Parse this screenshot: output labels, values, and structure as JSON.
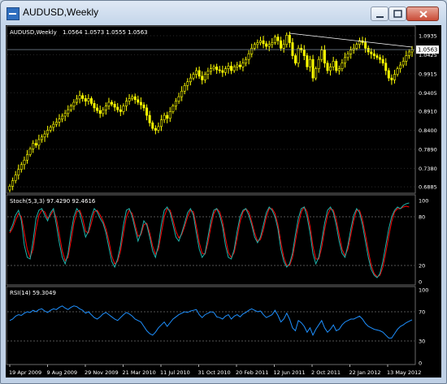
{
  "window": {
    "title": "AUDUSD,Weekly"
  },
  "buttons": {
    "minimize": "minimize",
    "maximize": "maximize",
    "close": "close"
  },
  "colors": {
    "background": "#000000",
    "candles": "#ffff00",
    "stoch_main": "#20b2aa",
    "stoch_signal": "#ff0000",
    "rsi_line": "#1e90ff",
    "text": "#ffffff",
    "grid": "#5a5a5a"
  },
  "chart_data": {
    "type": "candlestick",
    "symbol": "AUDUSD,Weekly",
    "header_values": "1.0564 1.0573 1.0555 1.0563",
    "price_ticks": [
      "1.0935",
      "1.0425",
      "0.9915",
      "0.9405",
      "0.8910",
      "0.8400",
      "0.7890",
      "0.7380",
      "0.6885"
    ],
    "current_price": "1.0563",
    "x_labels": [
      "19 Apr 2009",
      "9 Aug 2009",
      "29 Nov 2009",
      "21 Mar 2010",
      "11 Jul 2010",
      "31 Oct 2010",
      "20 Feb 2011",
      "12 Jun 2011",
      "2 Oct 2011",
      "22 Jan 2012",
      "13 May 2012"
    ],
    "price_close": [
      0.69,
      0.705,
      0.72,
      0.735,
      0.748,
      0.76,
      0.775,
      0.79,
      0.805,
      0.8,
      0.815,
      0.822,
      0.83,
      0.84,
      0.848,
      0.856,
      0.862,
      0.87,
      0.878,
      0.885,
      0.895,
      0.905,
      0.915,
      0.924,
      0.933,
      0.925,
      0.918,
      0.925,
      0.912,
      0.9,
      0.893,
      0.885,
      0.895,
      0.905,
      0.915,
      0.91,
      0.902,
      0.895,
      0.89,
      0.905,
      0.918,
      0.925,
      0.93,
      0.922,
      0.915,
      0.908,
      0.9,
      0.88,
      0.86,
      0.845,
      0.84,
      0.85,
      0.868,
      0.88,
      0.872,
      0.89,
      0.905,
      0.918,
      0.93,
      0.945,
      0.96,
      0.97,
      0.98,
      0.99,
      1.0,
      0.985,
      0.975,
      0.99,
      0.998,
      1.005,
      1.01,
      1.002,
      1.0,
      0.995,
      1.005,
      1.012,
      1.0,
      1.01,
      1.015,
      1.01,
      1.02,
      1.03,
      1.045,
      1.06,
      1.07,
      1.075,
      1.08,
      1.072,
      1.065,
      1.07,
      1.075,
      1.09,
      1.08,
      1.06,
      1.07,
      1.095,
      1.075,
      1.04,
      1.02,
      1.06,
      1.055,
      1.04,
      1.01,
      1.03,
      0.98,
      1.005,
      1.03,
      1.055,
      1.02,
      1.0,
      1.01,
      1.025,
      1.0,
      1.005,
      1.02,
      1.035,
      1.045,
      1.055,
      1.06,
      1.07,
      1.08,
      1.075,
      1.06,
      1.05,
      1.045,
      1.04,
      1.035,
      1.03,
      1.02,
      1.0,
      0.98,
      0.975,
      0.99,
      1.005,
      1.015,
      1.025,
      1.04,
      1.05,
      1.056
    ],
    "trendline": {
      "from_index": 96,
      "from_price": 1.1,
      "to_index": 138,
      "to_price": 1.063
    },
    "hline_price": 1.0563,
    "price_ylim": [
      0.68,
      1.1
    ],
    "stoch": {
      "label": "Stoch(5,3,3) 97.4290 92.4616",
      "levels": [
        "100",
        "80",
        "20",
        "0"
      ],
      "main": [
        62,
        70,
        82,
        88,
        75,
        45,
        30,
        28,
        50,
        78,
        88,
        90,
        82,
        75,
        85,
        90,
        70,
        48,
        30,
        22,
        35,
        60,
        80,
        90,
        85,
        70,
        55,
        62,
        80,
        90,
        86,
        78,
        72,
        60,
        42,
        25,
        18,
        28,
        45,
        70,
        88,
        90,
        80,
        65,
        50,
        60,
        75,
        70,
        55,
        38,
        30,
        45,
        70,
        88,
        92,
        85,
        70,
        55,
        50,
        60,
        72,
        85,
        90,
        82,
        60,
        40,
        30,
        35,
        55,
        75,
        88,
        90,
        82,
        68,
        45,
        30,
        28,
        40,
        62,
        80,
        88,
        90,
        82,
        70,
        55,
        48,
        55,
        70,
        85,
        92,
        88,
        80,
        65,
        40,
        25,
        18,
        22,
        35,
        58,
        78,
        90,
        92,
        80,
        60,
        35,
        22,
        30,
        50,
        72,
        88,
        92,
        85,
        70,
        50,
        35,
        30,
        45,
        65,
        82,
        90,
        85,
        70,
        50,
        30,
        15,
        8,
        5,
        10,
        25,
        45,
        65,
        80,
        88,
        92,
        90,
        94,
        96,
        97
      ],
      "signal": [
        60,
        66,
        76,
        84,
        80,
        60,
        40,
        30,
        40,
        65,
        82,
        88,
        86,
        78,
        82,
        88,
        78,
        58,
        38,
        26,
        30,
        50,
        72,
        86,
        88,
        78,
        62,
        60,
        72,
        86,
        88,
        82,
        75,
        65,
        50,
        32,
        22,
        25,
        38,
        60,
        80,
        88,
        84,
        70,
        56,
        58,
        70,
        72,
        60,
        44,
        34,
        40,
        60,
        80,
        90,
        88,
        76,
        62,
        54,
        58,
        68,
        80,
        88,
        86,
        68,
        48,
        35,
        34,
        48,
        68,
        84,
        90,
        86,
        74,
        54,
        36,
        30,
        36,
        54,
        74,
        86,
        90,
        86,
        74,
        60,
        50,
        52,
        64,
        80,
        90,
        90,
        84,
        70,
        48,
        30,
        20,
        20,
        30,
        50,
        70,
        86,
        92,
        86,
        68,
        44,
        28,
        28,
        42,
        64,
        82,
        90,
        88,
        76,
        58,
        40,
        32,
        40,
        58,
        76,
        88,
        88,
        76,
        58,
        38,
        20,
        10,
        6,
        8,
        18,
        36,
        56,
        74,
        86,
        90,
        90,
        92,
        93,
        92
      ]
    },
    "rsi": {
      "label": "RSI(14) 59.3049",
      "levels": [
        "100",
        "70",
        "30",
        "0"
      ],
      "values": [
        58,
        60,
        64,
        66,
        65,
        68,
        70,
        69,
        72,
        70,
        73,
        74,
        71,
        69,
        72,
        74,
        73,
        76,
        78,
        75,
        73,
        76,
        78,
        77,
        74,
        72,
        68,
        70,
        66,
        62,
        60,
        63,
        67,
        69,
        66,
        63,
        60,
        58,
        62,
        66,
        69,
        67,
        64,
        60,
        58,
        56,
        50,
        44,
        40,
        38,
        42,
        48,
        52,
        56,
        50,
        55,
        60,
        63,
        66,
        68,
        70,
        69,
        71,
        72,
        73,
        66,
        62,
        66,
        68,
        70,
        69,
        63,
        62,
        60,
        64,
        66,
        60,
        64,
        66,
        63,
        67,
        69,
        72,
        74,
        72,
        70,
        71,
        66,
        62,
        64,
        66,
        72,
        65,
        56,
        60,
        68,
        60,
        48,
        44,
        58,
        55,
        50,
        42,
        48,
        38,
        46,
        52,
        58,
        48,
        42,
        46,
        52,
        44,
        46,
        52,
        56,
        58,
        60,
        60,
        62,
        64,
        60,
        54,
        50,
        48,
        46,
        45,
        44,
        42,
        38,
        34,
        34,
        40,
        46,
        50,
        52,
        55,
        57,
        59
      ]
    }
  }
}
